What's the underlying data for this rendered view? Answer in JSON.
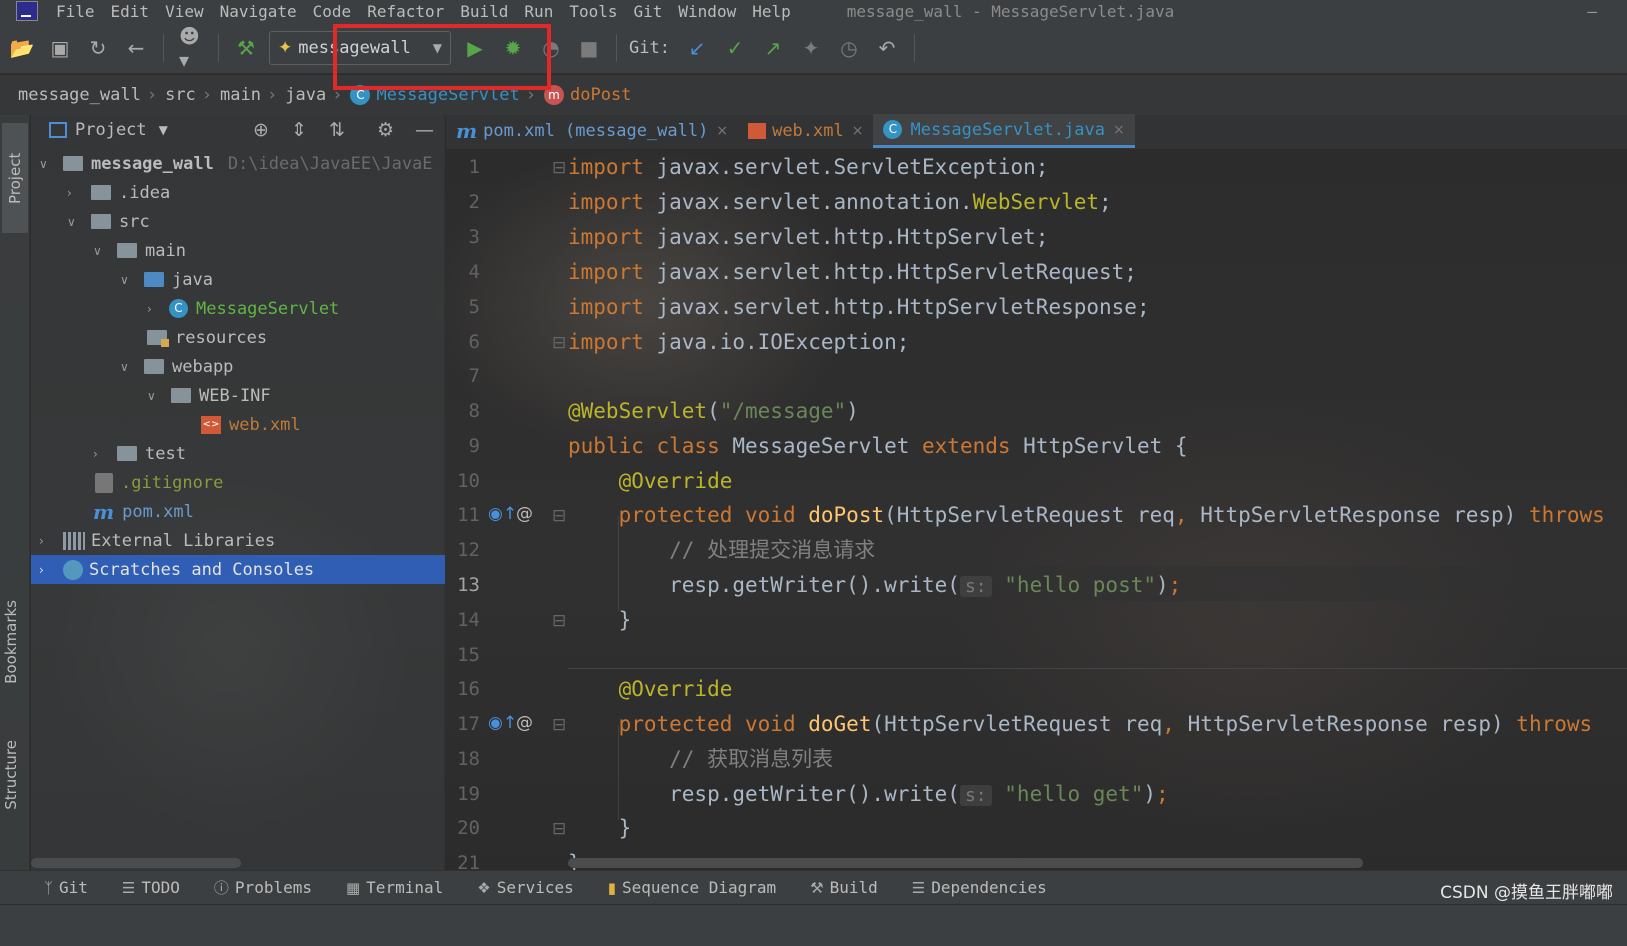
{
  "window": {
    "title": "message_wall - MessageServlet.java",
    "menus": [
      "File",
      "Edit",
      "View",
      "Navigate",
      "Code",
      "Refactor",
      "Build",
      "Run",
      "Tools",
      "Git",
      "Window",
      "Help"
    ],
    "minimize": "–"
  },
  "toolbar": {
    "run_config": "messagewall",
    "git_label": "Git:"
  },
  "breadcrumb": [
    "message_wall",
    "src",
    "main",
    "java",
    "MessageServlet",
    "doPost"
  ],
  "left_stripe": {
    "project": "Project",
    "bookmarks": "Bookmarks",
    "structure": "Structure"
  },
  "project_panel": {
    "title": "Project",
    "tree": [
      {
        "label": "message_wall",
        "path": "D:\\idea\\JavaEE\\JavaE"
      },
      {
        "label": ".idea"
      },
      {
        "label": "src"
      },
      {
        "label": "main"
      },
      {
        "label": "java"
      },
      {
        "label": "MessageServlet"
      },
      {
        "label": "resources"
      },
      {
        "label": "webapp"
      },
      {
        "label": "WEB-INF"
      },
      {
        "label": "web.xml"
      },
      {
        "label": "test"
      },
      {
        "label": ".gitignore"
      },
      {
        "label": "pom.xml"
      },
      {
        "label": "External Libraries"
      },
      {
        "label": "Scratches and Consoles"
      }
    ]
  },
  "tabs": [
    {
      "label": "pom.xml (message_wall)",
      "close": "×"
    },
    {
      "label": "web.xml",
      "close": "×"
    },
    {
      "label": "MessageServlet.java",
      "close": "×"
    }
  ],
  "editor": {
    "current_line": 13,
    "line_numbers": [
      "1",
      "2",
      "3",
      "4",
      "5",
      "6",
      "7",
      "8",
      "9",
      "10",
      "11",
      "12",
      "13",
      "14",
      "15",
      "16",
      "17",
      "18",
      "19",
      "20",
      "21"
    ]
  },
  "bottom_tabs": [
    "Git",
    "TODO",
    "Problems",
    "Terminal",
    "Services",
    "Sequence Diagram",
    "Build",
    "Dependencies"
  ],
  "watermark": "CSDN @摸鱼王胖嘟嘟",
  "colors": {
    "keyword": "#cc7832",
    "annotation": "#bbb529",
    "string": "#6a8759",
    "comment": "#808080",
    "method": "#ffc66d",
    "highlight_box": "#e02a2a",
    "selection": "#2f65ca"
  }
}
